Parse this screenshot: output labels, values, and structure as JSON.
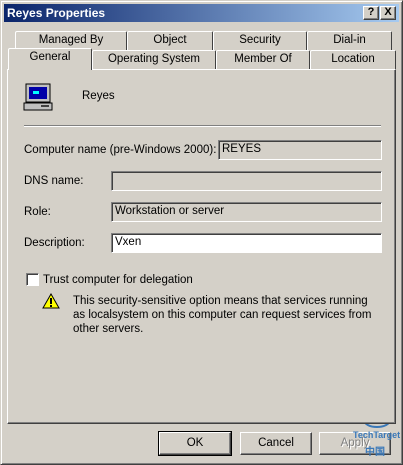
{
  "window": {
    "title": "Reyes Properties"
  },
  "titlebar_buttons": {
    "help": "?",
    "close": "X"
  },
  "tabs_row1": [
    "Managed By",
    "Object",
    "Security",
    "Dial-in"
  ],
  "tabs_row2": [
    "General",
    "Operating System",
    "Member Of",
    "Location"
  ],
  "active_tab": "General",
  "general": {
    "computer_display_name": "Reyes",
    "computer_name_label": "Computer name (pre-Windows 2000):",
    "computer_name_value": "REYES",
    "dns_label": "DNS name:",
    "dns_value": "",
    "role_label": "Role:",
    "role_value": "Workstation or server",
    "description_label": "Description:",
    "description_value": "Vxen",
    "trust_label": "Trust computer for delegation",
    "trust_checked": false,
    "warning_text": "This security-sensitive option means that services running as localsystem on this computer can request services from other servers."
  },
  "buttons": {
    "ok": "OK",
    "cancel": "Cancel",
    "apply": "Apply"
  },
  "icons": {
    "computer": "computer-icon",
    "warning": "warning-icon",
    "help": "help-icon",
    "close": "close-icon"
  },
  "colors": {
    "titlebar_start": "#0a246a",
    "titlebar_end": "#a6caf0",
    "face": "#d4d0c8"
  },
  "watermark": {
    "brand": "TechTarget",
    "sub": "中国"
  }
}
